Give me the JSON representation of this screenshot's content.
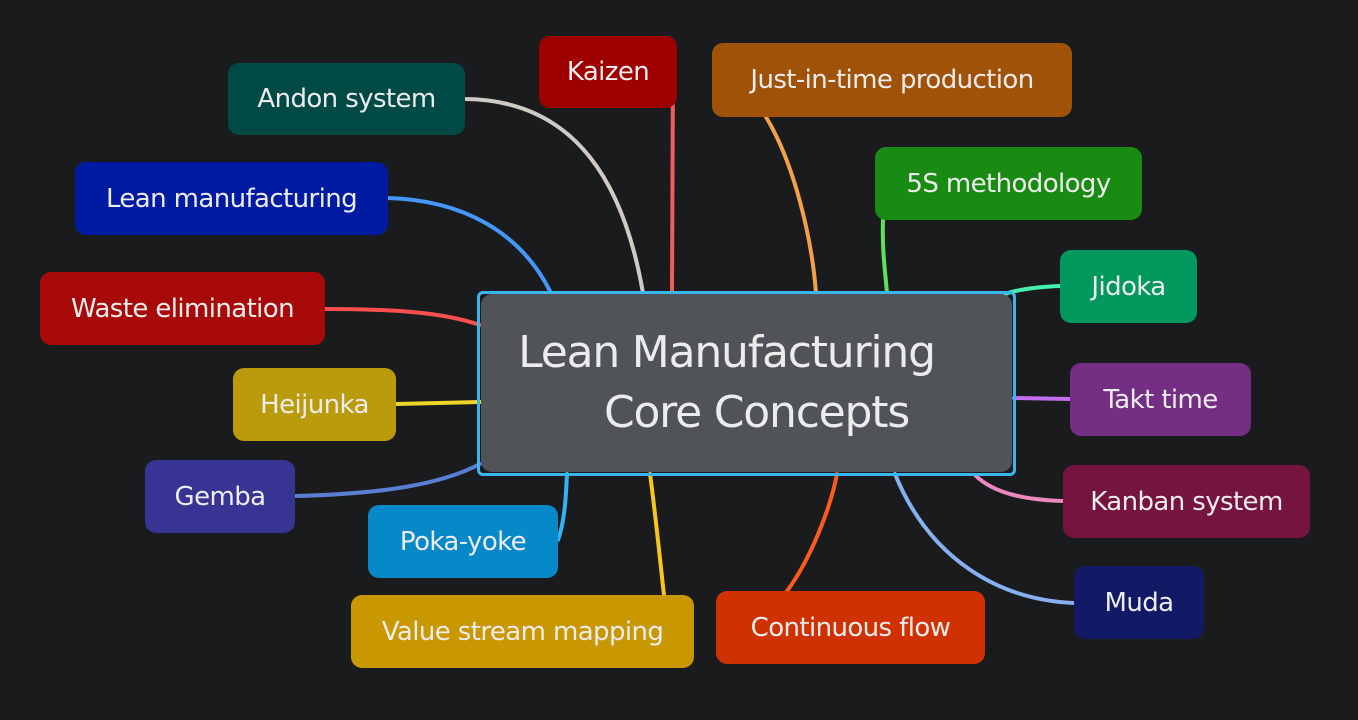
{
  "diagram": {
    "type": "mind-map",
    "background_color": "#1a1b1d",
    "root": {
      "title_line1": "Lean Manufacturing",
      "title_line2": "Core Concepts",
      "fill": "#505458",
      "outline": "#3bb6ec"
    },
    "branches": [
      {
        "id": "andon-system",
        "label": "Andon system",
        "fill": "#004a45",
        "line": "#cfcac4"
      },
      {
        "id": "kaizen",
        "label": "Kaizen",
        "fill": "#9e0000",
        "line": "#f25c5c"
      },
      {
        "id": "just-in-time-production",
        "label": "Just-in-time production",
        "fill": "#a05208",
        "line": "#f3a04a"
      },
      {
        "id": "5s-methodology",
        "label": "5S methodology",
        "fill": "#198a12",
        "line": "#5fe05a"
      },
      {
        "id": "jidoka",
        "label": "Jidoka",
        "fill": "#00985d",
        "line": "#44f0b0"
      },
      {
        "id": "takt-time",
        "label": "Takt time",
        "fill": "#742f85",
        "line": "#c36ef0"
      },
      {
        "id": "kanban-system",
        "label": "Kanban system",
        "fill": "#761440",
        "line": "#ef86c0"
      },
      {
        "id": "muda",
        "label": "Muda",
        "fill": "#121a66",
        "line": "#86b0f0"
      },
      {
        "id": "continuous-flow",
        "label": "Continuous flow",
        "fill": "#cf3200",
        "line": "#ff5a1f"
      },
      {
        "id": "value-stream-mapping",
        "label": "Value stream mapping",
        "fill": "#c99700",
        "line": "#f7c520"
      },
      {
        "id": "poka-yoke",
        "label": "Poka-yoke",
        "fill": "#0788c8",
        "line": "#30b4f2"
      },
      {
        "id": "gemba",
        "label": "Gemba",
        "fill": "#383493",
        "line": "#5a7ed2"
      },
      {
        "id": "heijunka",
        "label": "Heijunka",
        "fill": "#b99b0b",
        "line": "#f0d62a"
      },
      {
        "id": "waste-elimination",
        "label": "Waste elimination",
        "fill": "#a80a0a",
        "line": "#ff4f4f"
      },
      {
        "id": "lean-manufacturing",
        "label": "Lean manufacturing",
        "fill": "#001ba2",
        "line": "#4598fa"
      }
    ]
  }
}
